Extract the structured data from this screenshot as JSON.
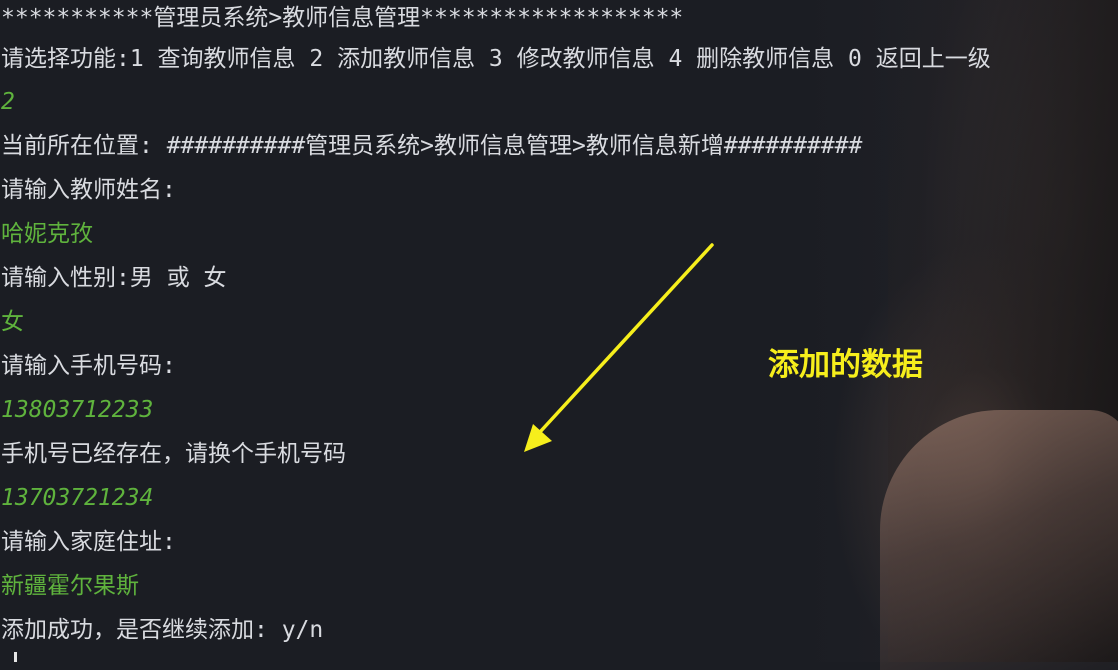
{
  "terminal": {
    "lines": [
      {
        "text": "***********管理员系统>教师信息管理*******************",
        "kind": "output"
      },
      {
        "text": "请选择功能:1 查询教师信息 2 添加教师信息 3 修改教师信息 4 删除教师信息 0 返回上一级",
        "kind": "output"
      },
      {
        "text": "2",
        "kind": "input"
      },
      {
        "text": "当前所在位置: ##########管理员系统>教师信息管理>教师信息新增##########",
        "kind": "output"
      },
      {
        "text": "请输入教师姓名:",
        "kind": "output"
      },
      {
        "text": "哈妮克孜",
        "kind": "input"
      },
      {
        "text": "请输入性别:男 或 女",
        "kind": "output"
      },
      {
        "text": "女",
        "kind": "input"
      },
      {
        "text": "请输入手机号码:",
        "kind": "output"
      },
      {
        "text": "13803712233",
        "kind": "input"
      },
      {
        "text": "手机号已经存在，请换个手机号码",
        "kind": "output"
      },
      {
        "text": "13703721234",
        "kind": "input"
      },
      {
        "text": "请输入家庭住址:",
        "kind": "output"
      },
      {
        "text": "新疆霍尔果斯",
        "kind": "input"
      },
      {
        "text": "添加成功，是否继续添加: y/n",
        "kind": "output"
      }
    ]
  },
  "annotation": {
    "label": "添加的数据",
    "color": "#f6ee1c"
  },
  "colors": {
    "background": "#1b1d23",
    "output_text": "#d9dbe0",
    "input_text": "#5fb33d"
  }
}
